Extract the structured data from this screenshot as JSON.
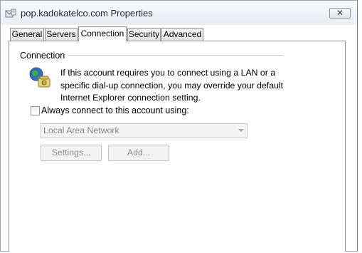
{
  "window": {
    "title": "pop.kadokatelco.com Properties",
    "close_label": "✕"
  },
  "tabs": [
    {
      "label": "General",
      "active": false
    },
    {
      "label": "Servers",
      "active": false
    },
    {
      "label": "Connection",
      "active": true
    },
    {
      "label": "Security",
      "active": false
    },
    {
      "label": "Advanced",
      "active": false
    }
  ],
  "connection": {
    "group_label": "Connection",
    "description": "If this account requires you to connect using a LAN or a specific dial-up connection, you may override your default Internet Explorer connection setting.",
    "checkbox_label": "Always connect to this account using:",
    "checkbox_checked": false,
    "select_value": "Local Area Network",
    "settings_button": "Settings...",
    "add_button": "Add..."
  },
  "icons": {
    "title": "mail-properties-icon",
    "connection": "globe-phone-icon",
    "select": "chevron-down-icon"
  },
  "colors": {
    "disabled_text": "#8a8a8a",
    "window_border": "#9aa7b6",
    "tab_border": "#8e8f8f"
  }
}
